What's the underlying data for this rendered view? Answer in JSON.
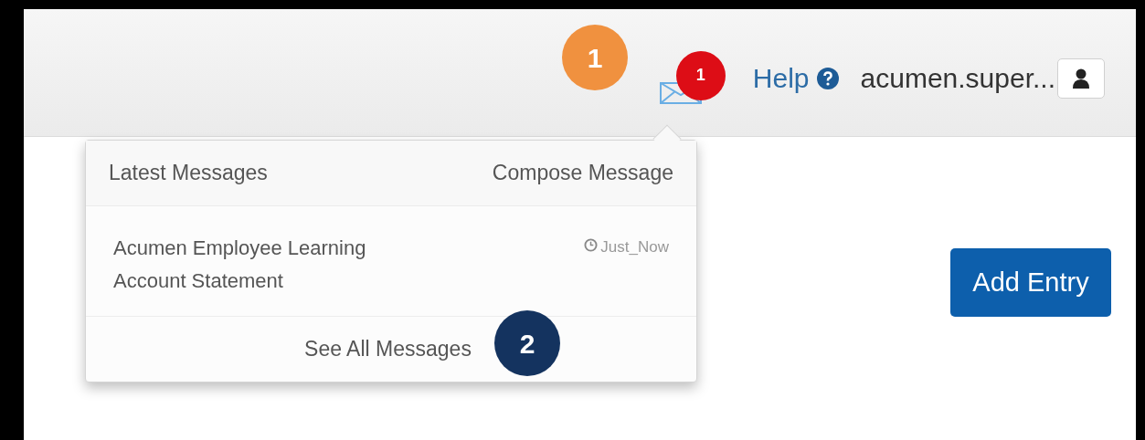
{
  "header": {
    "messages_badge": "1",
    "help": "Help",
    "user": "acumen.super..."
  },
  "messages_menu": {
    "title": "Latest Messages",
    "compose": "Compose Message",
    "messages": [
      {
        "subject": "Acumen Employee Learning Account Statement",
        "time": "Just_Now"
      }
    ],
    "see_all": "See All Messages"
  },
  "add_entry": "Add Entry",
  "callouts": [
    {
      "label": "1",
      "color": "#f0913f"
    },
    {
      "label": "2",
      "color": "#14335f"
    }
  ]
}
